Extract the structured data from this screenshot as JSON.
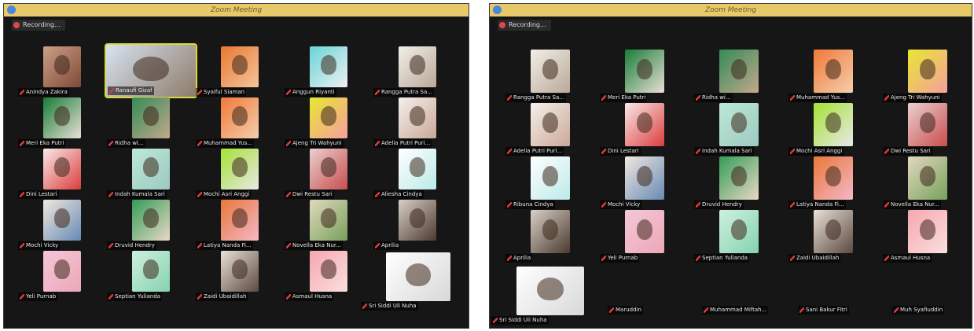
{
  "window_title": "Zoom Meeting",
  "recording_label": "Recording...",
  "colors": {
    "titlebar": "#e7c969",
    "background": "#161616",
    "active_speaker": "#d9d94a",
    "muted_icon": "#e03a3a"
  },
  "left_window": {
    "participants": [
      "Anindya Zakira",
      "Ranaufi Gizaf",
      "Syaiful Siaman",
      "Anggun Riyanti",
      "Rangga Putra Sa...",
      "Meri Eka Putri",
      "Ridha wi...",
      "Muhammad Yus...",
      "Ajeng Tri Wahyuni",
      "Adelia Putri Puri...",
      "Dini Lestari",
      "Indah Kumala Sari",
      "Mochi Asri Anggi",
      "Dwi Restu Sari",
      "Aliesha Cindya",
      "Mochi Vicky",
      "Druvid Hendry",
      "Latiya Nanda Fi...",
      "Novella Eka Nur...",
      "Aprilia",
      "Yeli Purnab",
      "Septian Yulianda",
      "Zaidi Ubaidillah",
      "Asmaul Husna",
      "Sri Siddi Uli Nuha"
    ]
  },
  "right_window": {
    "participants": [
      "Rangga Putra Sa...",
      "Meri Eka Putri",
      "Ridha wi...",
      "Muhammad Yus...",
      "Ajeng Tri Wahyuni",
      "Adelia Putri Puri...",
      "Dini Lestari",
      "Indah Kumala Sari",
      "Mochi Asri Anggi",
      "Dwi Restu Sari",
      "Ribuna Cindya",
      "Mochi Vicky",
      "Druvid Hendry",
      "Latiya Nanda Fi...",
      "Novella Eka Nur...",
      "Aprilia",
      "Yeli Purnab",
      "Septian Yulianda",
      "Zaidi Ubaidillah",
      "Asmaul Husna",
      "Sri Siddi Uli Nuha",
      "Maruddin",
      "Muhammad Miftah...",
      "Sani Bakur Fitri",
      "Muh Syafiuddin"
    ]
  }
}
